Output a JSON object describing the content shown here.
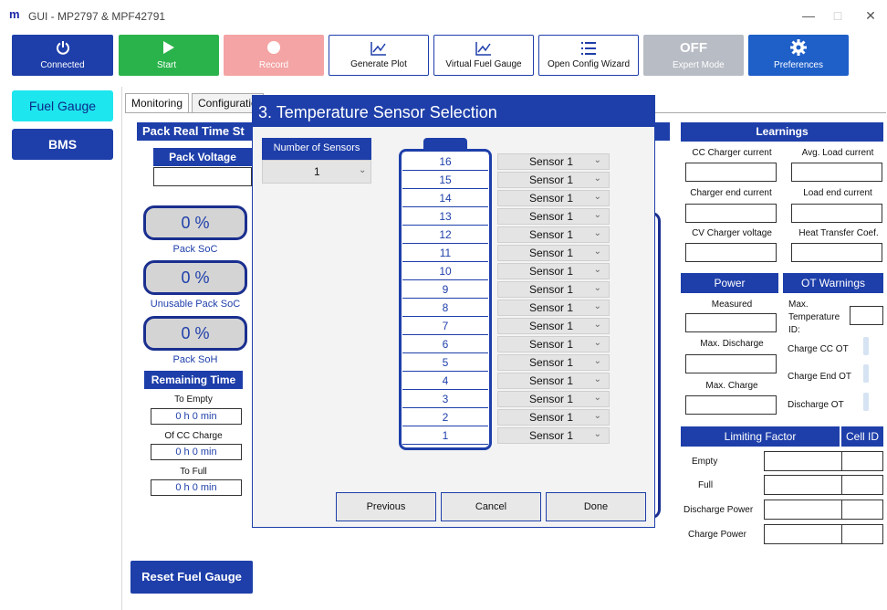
{
  "window": {
    "logo": "m",
    "title": "GUI - MP2797 & MPF42791",
    "minimize": "—",
    "maximize": "□",
    "close": "✕"
  },
  "toolbar": {
    "connected": "Connected",
    "start": "Start",
    "record": "Record",
    "generate_plot": "Generate Plot",
    "virtual_fuel_gauge": "Virtual Fuel Gauge",
    "open_config_wizard": "Open Config Wizard",
    "expert_off": "OFF",
    "expert_mode": "Expert Mode",
    "preferences": "Preferences"
  },
  "sidebar": {
    "fuel_gauge": "Fuel Gauge",
    "bms": "BMS"
  },
  "tabs": {
    "monitoring": "Monitoring",
    "configuration": "Configuratio"
  },
  "left": {
    "pack_real_time": "Pack Real Time St",
    "pack_voltage": "Pack Voltage",
    "soc_value": "0 %",
    "soc_label": "Pack SoC",
    "unusable_value": "0 %",
    "unusable_label": "Unusable Pack SoC",
    "soh_value": "0 %",
    "soh_label": "Pack SoH",
    "remaining_time": "Remaining Time",
    "to_empty": "To Empty",
    "to_empty_val": "0 h   0 min",
    "of_cc_charge": "Of CC Charge",
    "of_cc_val": "0 h   0 min",
    "to_full": "To Full",
    "to_full_val": "0 h   0 min",
    "reset": "Reset Fuel Gauge"
  },
  "right": {
    "learnings": "Learnings",
    "cc_charger_current": "CC Charger current",
    "avg_load_current": "Avg. Load current",
    "charger_end_current": "Charger end current",
    "load_end_current": "Load end current",
    "cv_charger_voltage": "CV Charger voltage",
    "heat_transfer": "Heat Transfer Coef.",
    "power": "Power",
    "ot_warnings": "OT Warnings",
    "measured": "Measured",
    "max_temp": "Max.",
    "max_temp2": "Temperature",
    "max_temp3": "ID:",
    "max_discharge": "Max. Discharge",
    "charge_cc_ot": "Charge CC OT",
    "charge_end_ot": "Charge End OT",
    "max_charge": "Max. Charge",
    "discharge_ot": "Discharge OT",
    "limiting_factor": "Limiting Factor",
    "cell_id": "Cell ID",
    "empty": "Empty",
    "full": "Full",
    "discharge_power": "Discharge Power",
    "charge_power": "Charge Power"
  },
  "dialog": {
    "title": "3. Temperature Sensor Selection",
    "num_sensors_label": "Number of Sensors",
    "num_sensors_value": "1",
    "rows": [
      "16",
      "15",
      "14",
      "13",
      "12",
      "11",
      "10",
      "9",
      "8",
      "7",
      "6",
      "5",
      "4",
      "3",
      "2",
      "1"
    ],
    "sensor_option": "Sensor 1",
    "previous": "Previous",
    "cancel": "Cancel",
    "done": "Done"
  }
}
